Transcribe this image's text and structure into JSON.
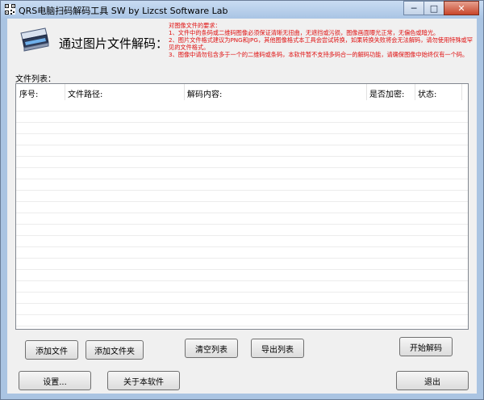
{
  "window": {
    "title": "QRS电脑扫码解码工具 SW  by Lizcst Software Lab",
    "controls": {
      "minimize": "─",
      "maximize": "□",
      "close": "✕"
    }
  },
  "header": {
    "heading": "通过图片文件解码：",
    "requirements": [
      "对图像文件的要求：",
      "1、文件中的条码或二维码图像必须保证清晰无扭曲，无遮挡或污损，图像画面曝光正常，无偏色或暗光。",
      "2、图片文件格式建议为PNG和JPG，其他图像格式本工具会尝试转换，如果转换失败将会无法解码，请勿使用特殊或罕见的文件格式。",
      "3、图像中请勿包含多于一个的二维码或条码，本软件暂不支持多码合一的解码功能，请确保图像中始终仅有一个码。"
    ]
  },
  "file_list": {
    "label": "文件列表：",
    "columns": [
      "序号:",
      "文件路径:",
      "解码内容:",
      "是否加密:",
      "状态:"
    ],
    "rows": []
  },
  "buttons": {
    "add_file": "添加文件",
    "add_folder": "添加文件夹",
    "clear_list": "清空列表",
    "export_list": "导出列表",
    "start_decode": "开始解码",
    "settings": "设置...",
    "about": "关于本软件",
    "exit": "退出"
  }
}
